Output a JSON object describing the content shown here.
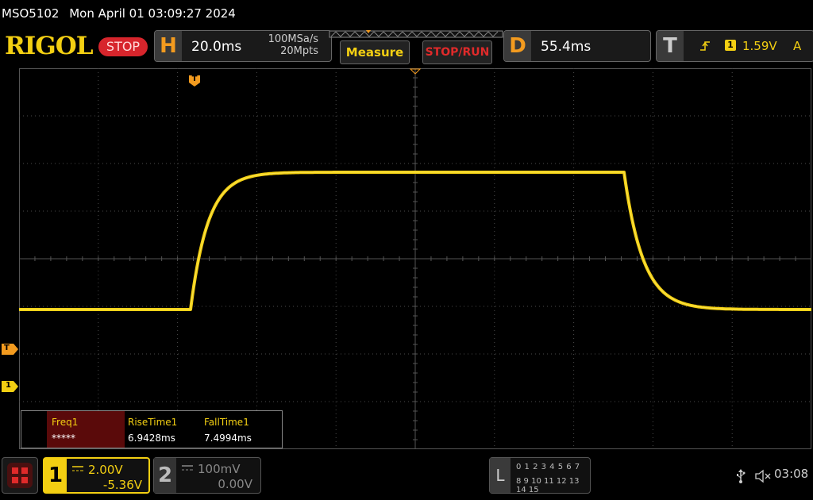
{
  "titlebar": {
    "model": "MSO5102",
    "datetime": "Mon April 01 03:09:27 2024"
  },
  "brand": {
    "logo": "RIGOL",
    "state": "STOP"
  },
  "horizontal": {
    "letter": "H",
    "timebase": "20.0ms",
    "sample_rate": "100MSa/s",
    "memory_depth": "20Mpts"
  },
  "toolbar": {
    "measure_label": "Measure",
    "stoprun_label": "STOP/RUN"
  },
  "delay": {
    "letter": "D",
    "value": "55.4ms"
  },
  "trigger": {
    "letter": "T",
    "source": "1",
    "level": "1.59V",
    "mode": "A"
  },
  "markers": {
    "trigger_top": "T",
    "trigger_left": "T",
    "ch1_left": "1"
  },
  "measurements": {
    "columns": [
      {
        "name": "Freq1",
        "value": "*****"
      },
      {
        "name": "RiseTime1",
        "value": "6.9428ms"
      },
      {
        "name": "FallTime1",
        "value": "7.4994ms"
      }
    ]
  },
  "channel1": {
    "number": "1",
    "scale": "2.00V",
    "offset": "-5.36V"
  },
  "channel2": {
    "number": "2",
    "scale": "100mV",
    "offset": "0.00V"
  },
  "logic": {
    "letter": "L",
    "row1": "0 1 2 3   4 5 6 7",
    "row2": "8 9 10 11  12 13 14 15"
  },
  "status_bar": {
    "time": "03:08"
  },
  "icons": [
    "usb-icon",
    "mute-icon",
    "menu-icon",
    "trigger-edge-icon"
  ],
  "colors": {
    "ch1": "#f3cf12",
    "trigger": "#f39b1f",
    "stop": "#d7252c",
    "grid": "#555555"
  },
  "waveform": {
    "description_levels": {
      "low_divisions": -1.0,
      "high_divisions": 1.8
    }
  }
}
